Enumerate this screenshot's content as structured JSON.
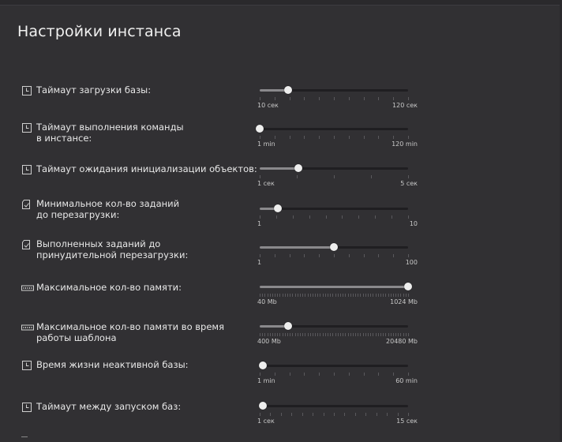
{
  "title": "Настройки инстанса",
  "settings": [
    {
      "label": "Таймаут загрузки базы:",
      "icon": "clock-icon",
      "min": "10 сек",
      "max": "120 сек",
      "value": 0.19,
      "ticks": 11
    },
    {
      "label": "Таймаут выполнения команды\nв инстансе:",
      "icon": "clock-icon",
      "min": "1 min",
      "max": "120 min",
      "value": 0.0,
      "ticks": 11
    },
    {
      "label": "Таймаут ожидания инициализации объектов:",
      "icon": "clock-icon",
      "min": "1 сек",
      "max": "5 сек",
      "value": 0.26,
      "ticks": 5
    },
    {
      "label": "Минимальное кол-во заданий\nдо перезагрузки:",
      "icon": "task-icon",
      "min": "1",
      "max": "10",
      "value": 0.12,
      "ticks": 10
    },
    {
      "label": "Выполненных заданий до\nпринудительной перезагрузки:",
      "icon": "task-icon",
      "min": "1",
      "max": "100",
      "value": 0.5,
      "ticks": 11
    },
    {
      "label": "Максимальное кол-во памяти:",
      "icon": "memory-icon",
      "min": "40 Mb",
      "max": "1024 Mb",
      "value": 1.0,
      "ticks": 60
    },
    {
      "label": "Максимальное кол-во памяти во время\nработы шаблона",
      "icon": "memory-icon",
      "min": "400 Mb",
      "max": "20480 Mb",
      "value": 0.19,
      "ticks": 60
    },
    {
      "label": "Время жизни неактивной базы:",
      "icon": "clock-icon",
      "min": "1 min",
      "max": "60 min",
      "value": 0.02,
      "ticks": 11
    },
    {
      "label": "Таймаут между запуском баз:",
      "icon": "clock-icon",
      "min": "1 сек",
      "max": "15 сек",
      "value": 0.02,
      "ticks": 15
    }
  ]
}
